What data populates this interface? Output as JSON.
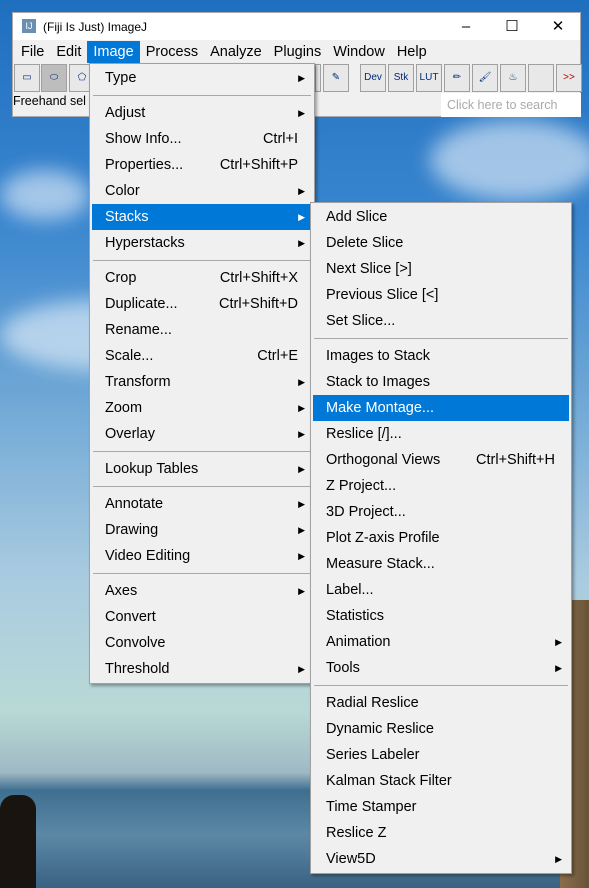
{
  "window": {
    "title": "(Fiji Is Just) ImageJ",
    "controls": [
      "minimize",
      "maximize",
      "close"
    ]
  },
  "menubar": [
    "File",
    "Edit",
    "Image",
    "Process",
    "Analyze",
    "Plugins",
    "Window",
    "Help"
  ],
  "menubar_active": "Image",
  "toolbar": {
    "left": [
      {
        "icon": "rectangle-icon"
      },
      {
        "icon": "oval-icon",
        "pressed": true
      },
      {
        "icon": "polygon-icon"
      }
    ],
    "right": [
      {
        "icon": "dropper-icon"
      },
      {
        "label": "Dev"
      },
      {
        "label": "Stk"
      },
      {
        "label": "LUT"
      },
      {
        "icon": "pencil-icon"
      },
      {
        "icon": "brush-icon"
      },
      {
        "icon": "flood-fill-icon"
      },
      {
        "label": ""
      },
      {
        "label": ">>"
      }
    ]
  },
  "status": "Freehand sel",
  "search_placeholder": "Click here to search",
  "colors": {
    "highlight": "#0078d7",
    "menu_bg": "#f0f0f0"
  },
  "image_menu": [
    {
      "label": "Type",
      "submenu": true
    },
    {
      "sep": true
    },
    {
      "label": "Adjust",
      "submenu": true
    },
    {
      "label": "Show Info...",
      "shortcut": "Ctrl+I"
    },
    {
      "label": "Properties...",
      "shortcut": "Ctrl+Shift+P"
    },
    {
      "label": "Color",
      "submenu": true
    },
    {
      "label": "Stacks",
      "submenu": true,
      "highlighted": true
    },
    {
      "label": "Hyperstacks",
      "submenu": true
    },
    {
      "sep": true
    },
    {
      "label": "Crop",
      "shortcut": "Ctrl+Shift+X"
    },
    {
      "label": "Duplicate...",
      "shortcut": "Ctrl+Shift+D"
    },
    {
      "label": "Rename..."
    },
    {
      "label": "Scale...",
      "shortcut": "Ctrl+E"
    },
    {
      "label": "Transform",
      "submenu": true
    },
    {
      "label": "Zoom",
      "submenu": true
    },
    {
      "label": "Overlay",
      "submenu": true
    },
    {
      "sep": true
    },
    {
      "label": "Lookup Tables",
      "submenu": true
    },
    {
      "sep": true
    },
    {
      "label": "Annotate",
      "submenu": true
    },
    {
      "label": "Drawing",
      "submenu": true
    },
    {
      "label": "Video Editing",
      "submenu": true
    },
    {
      "sep": true
    },
    {
      "label": "Axes",
      "submenu": true
    },
    {
      "label": "Convert"
    },
    {
      "label": "Convolve"
    },
    {
      "label": "Threshold",
      "submenu": true
    }
  ],
  "stacks_menu": [
    {
      "label": "Add Slice"
    },
    {
      "label": "Delete Slice"
    },
    {
      "label": "Next Slice [>]"
    },
    {
      "label": "Previous Slice [<]"
    },
    {
      "label": "Set Slice..."
    },
    {
      "sep": true
    },
    {
      "label": "Images to Stack"
    },
    {
      "label": "Stack to Images"
    },
    {
      "label": "Make Montage...",
      "highlighted": true
    },
    {
      "label": "Reslice [/]..."
    },
    {
      "label": "Orthogonal Views",
      "shortcut": "Ctrl+Shift+H"
    },
    {
      "label": "Z Project..."
    },
    {
      "label": "3D Project..."
    },
    {
      "label": "Plot Z-axis Profile"
    },
    {
      "label": "Measure Stack..."
    },
    {
      "label": "Label..."
    },
    {
      "label": "Statistics"
    },
    {
      "label": "Animation",
      "submenu": true
    },
    {
      "label": "Tools",
      "submenu": true
    },
    {
      "sep": true
    },
    {
      "label": "Radial Reslice"
    },
    {
      "label": "Dynamic Reslice"
    },
    {
      "label": "Series Labeler"
    },
    {
      "label": "Kalman Stack Filter"
    },
    {
      "label": "Time Stamper"
    },
    {
      "label": "Reslice Z"
    },
    {
      "label": "View5D",
      "submenu": true
    }
  ]
}
